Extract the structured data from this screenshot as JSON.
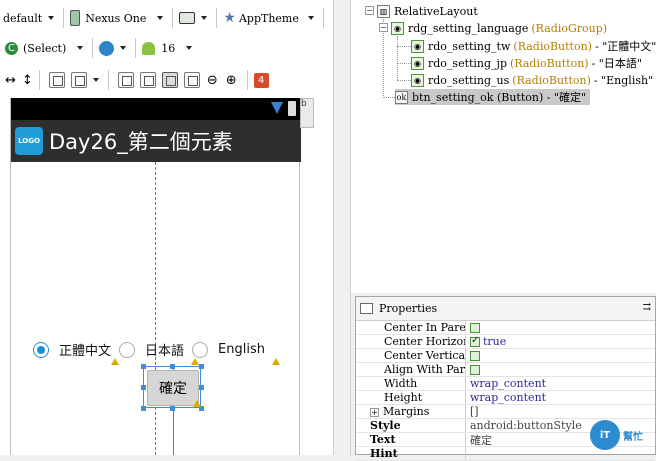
{
  "toolbar1": {
    "config": "default",
    "device": "Nexus One",
    "theme": "AppTheme"
  },
  "toolbar2": {
    "locale": "(Select)",
    "api_level": "16"
  },
  "toolbar3": {
    "error_count": "4"
  },
  "device": {
    "app_logo_text": "LOGO",
    "app_title": "Day26_第二個元素",
    "scroll_corner": "b"
  },
  "layout": {
    "radios": [
      {
        "label": "正體中文",
        "checked": true
      },
      {
        "label": "日本語",
        "checked": false
      },
      {
        "label": "English",
        "checked": false
      }
    ],
    "button_label": "確定"
  },
  "outline": {
    "root": "RelativeLayout",
    "group_id": "rdg_setting_language",
    "group_type": "(RadioGroup)",
    "children": [
      {
        "id": "rdo_setting_tw",
        "type": "(RadioButton)",
        "text": "- \"正體中文\""
      },
      {
        "id": "rdo_setting_jp",
        "type": "(RadioButton)",
        "text": "- \"日本語\""
      },
      {
        "id": "rdo_setting_us",
        "type": "(RadioButton)",
        "text": "- \"English\""
      }
    ],
    "button": "btn_setting_ok (Button) - \"確定\""
  },
  "properties": {
    "title": "Properties",
    "rows": [
      {
        "name": "Center In Parent",
        "value": "",
        "check": true,
        "checked": false
      },
      {
        "name": "Center Horizontal",
        "value": "true",
        "check": true,
        "checked": true
      },
      {
        "name": "Center Vertical",
        "value": "",
        "check": true,
        "checked": false
      },
      {
        "name": "Align With Par...",
        "value": "",
        "check": true,
        "checked": false
      },
      {
        "name": "Width",
        "value": "wrap_content",
        "check": false
      },
      {
        "name": "Height",
        "value": "wrap_content",
        "check": false
      },
      {
        "name": "Margins",
        "value": "[]",
        "check": false
      },
      {
        "name": "Style",
        "value": "android:buttonStyle",
        "check": false
      },
      {
        "name": "Text",
        "value": "確定",
        "check": false
      },
      {
        "name": "Hint",
        "value": "",
        "check": false
      }
    ]
  },
  "watermark": {
    "circle": "iT",
    "text": "幫忙"
  }
}
